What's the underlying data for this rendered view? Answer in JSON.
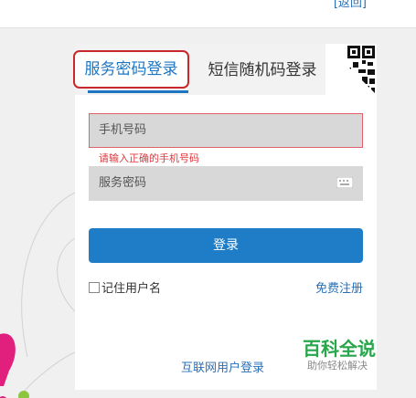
{
  "header": {
    "back_link": "[返回]"
  },
  "tabs": [
    {
      "label": "服务密码登录",
      "active": true
    },
    {
      "label": "短信随机码登录",
      "active": false
    }
  ],
  "form": {
    "phone_placeholder": "手机号码",
    "phone_error": "请输入正确的手机号码",
    "password_placeholder": "服务密码",
    "login_button": "登录",
    "remember_label": "记住用户名",
    "register_link": "免费注册",
    "internet_login": "互联网用户登录"
  },
  "watermark": {
    "title": "百科全说",
    "subtitle": "助你轻松解决"
  },
  "colors": {
    "accent": "#1e7dc6",
    "error": "#e1373c",
    "tab_highlight": "#c8282b",
    "watermark": "#27a64a"
  },
  "icons": {
    "keyboard": "keyboard-icon",
    "qr": "qr-code-icon"
  }
}
